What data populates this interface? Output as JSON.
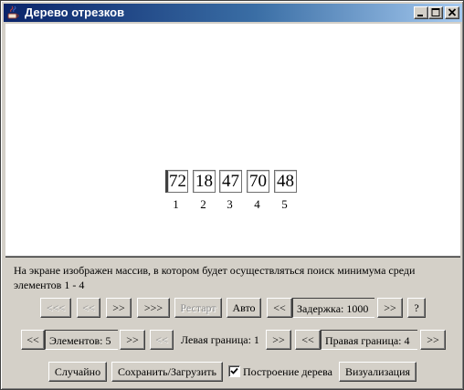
{
  "window": {
    "title": "Дерево отрезков",
    "controls": {
      "minimize": "minimize-icon",
      "maximize": "maximize-icon",
      "close": "close-icon"
    }
  },
  "array": {
    "values": [
      "72",
      "18",
      "47",
      "70",
      "48"
    ],
    "indices": [
      "1",
      "2",
      "3",
      "4",
      "5"
    ]
  },
  "description": "На экране изображен массив, в котором будет осуществляться поиск минимума среди элементов 1 - 4",
  "row1": {
    "first": "<<<",
    "prev": "<<",
    "next": ">>",
    "last": ">>>",
    "restart": "Рестарт",
    "auto": "Авто",
    "delay_dec": "<<",
    "delay_label": "Задержка: 1000",
    "delay_inc": ">>",
    "help": "?"
  },
  "row2": {
    "elements_dec": "<<",
    "elements_label": "Элементов: 5",
    "elements_inc": ">>",
    "left_dec": "<<",
    "left_label": "Левая граница: 1",
    "left_inc": ">>",
    "right_dec": "<<",
    "right_label": "Правая граница: 4",
    "right_inc": ">>"
  },
  "row3": {
    "random": "Случайно",
    "save_load": "Сохранить/Загрузить",
    "build_tree_label": "Построение дерева",
    "build_tree_checked": true,
    "visualize": "Визуализация"
  },
  "colors": {
    "title_start": "#0a246a",
    "title_end": "#a6caf0",
    "face": "#d4d0c8",
    "canvas": "#ffffff"
  }
}
